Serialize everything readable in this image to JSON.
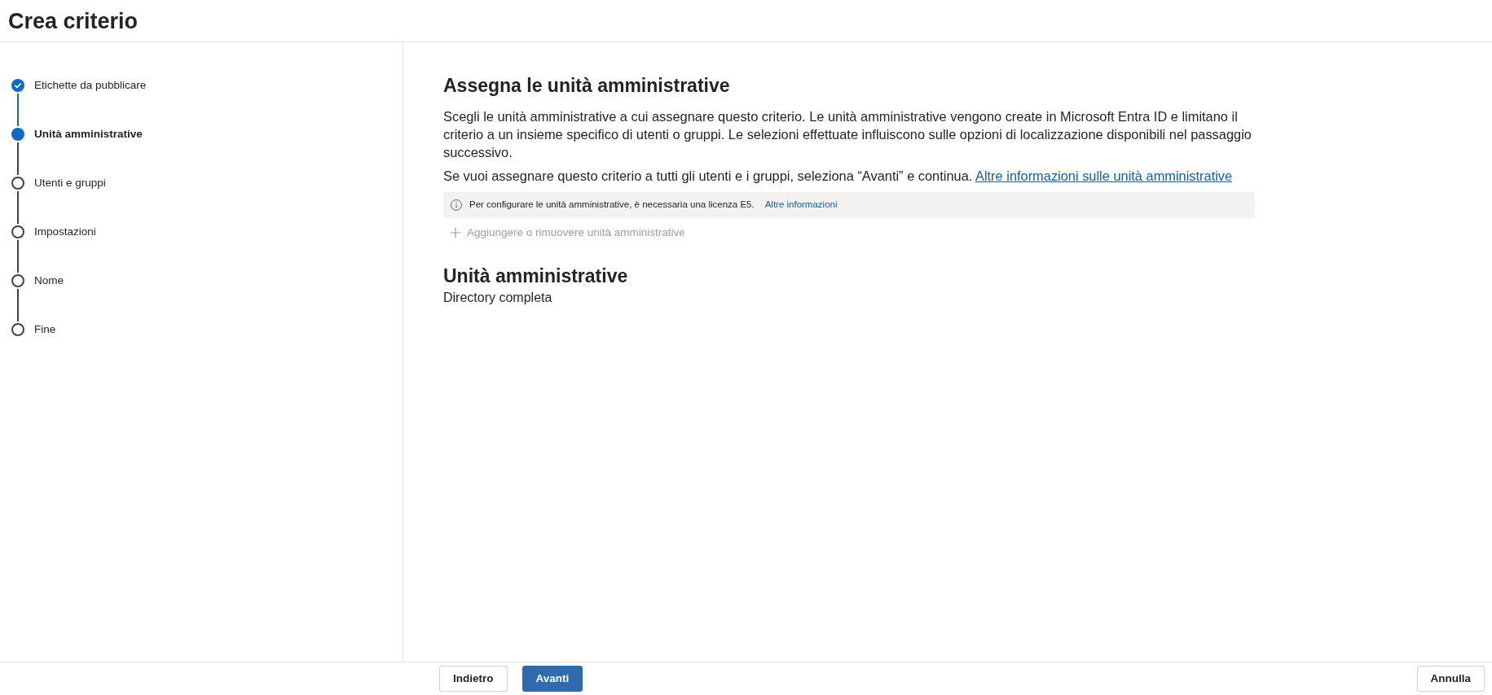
{
  "window": {
    "title": "Crea criterio"
  },
  "steps": [
    {
      "label": "Etichette da pubblicare",
      "completed": true,
      "selected": false
    },
    {
      "label": "Unità amministrative",
      "completed": false,
      "selected": true
    },
    {
      "label": "Utenti e gruppi",
      "completed": false,
      "selected": false
    },
    {
      "label": "Impostazioni",
      "completed": false,
      "selected": false
    },
    {
      "label": "Nome",
      "completed": false,
      "selected": false
    },
    {
      "label": "Fine",
      "completed": false,
      "selected": false
    }
  ],
  "main": {
    "heading": "Assegna le unità amministrative",
    "description": "Scegli le unità amministrative a cui assegnare questo criterio. Le unità amministrative vengono create in Microsoft Entra ID e limitano il criterio a un insieme specifico di utenti o gruppi. Le selezioni effettuate influiscono sulle opzioni di localizzazione disponibili nel passaggio successivo.",
    "note": {
      "text": "Se vuoi assegnare questo criterio a tutti gli utenti e i gruppi, seleziona “Avanti” e continua.",
      "link": "Altre informazioni sulle unità amministrative"
    },
    "info_bar": {
      "text": "Per configurare le unità amministrative, è necessaria una licenza E5.",
      "link": "Altre informazioni"
    },
    "add_button": {
      "label": "Aggiungere o rimuovere unità amministrative",
      "disabled": true
    },
    "section": {
      "heading": "Unità amministrative",
      "value": "Directory completa"
    }
  },
  "footer": {
    "buttons": [
      {
        "label": "Indietro",
        "kind": "default"
      },
      {
        "label": "Avanti",
        "kind": "primary"
      }
    ],
    "cancel_button": {
      "label": "Annulla"
    }
  }
}
